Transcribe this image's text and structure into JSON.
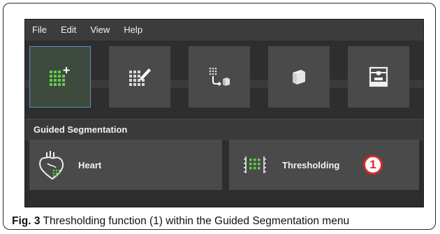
{
  "menubar": {
    "items": [
      "File",
      "Edit",
      "View",
      "Help"
    ]
  },
  "toolbar": {
    "buttons": [
      {
        "icon": "new-segmentation-icon",
        "active": true
      },
      {
        "icon": "edit-segmentation-icon",
        "active": false
      },
      {
        "icon": "points-to-object-icon",
        "active": false
      },
      {
        "icon": "cube-icon",
        "active": false
      },
      {
        "icon": "3d-printer-icon",
        "active": false
      }
    ]
  },
  "guided_segmentation": {
    "title": "Guided Segmentation",
    "items": [
      {
        "label": "Heart",
        "icon": "heart-icon"
      },
      {
        "label": "Thresholding",
        "icon": "thresholding-icon",
        "annotation": "1"
      }
    ]
  },
  "caption": {
    "fig_label": "Fig. 3",
    "text": " Thresholding function (1) within the Guided Segmentation menu"
  },
  "colors": {
    "accent_green": "#5fcf4a",
    "annotation_red": "#d42a2a",
    "active_border": "#5b8fc7"
  }
}
